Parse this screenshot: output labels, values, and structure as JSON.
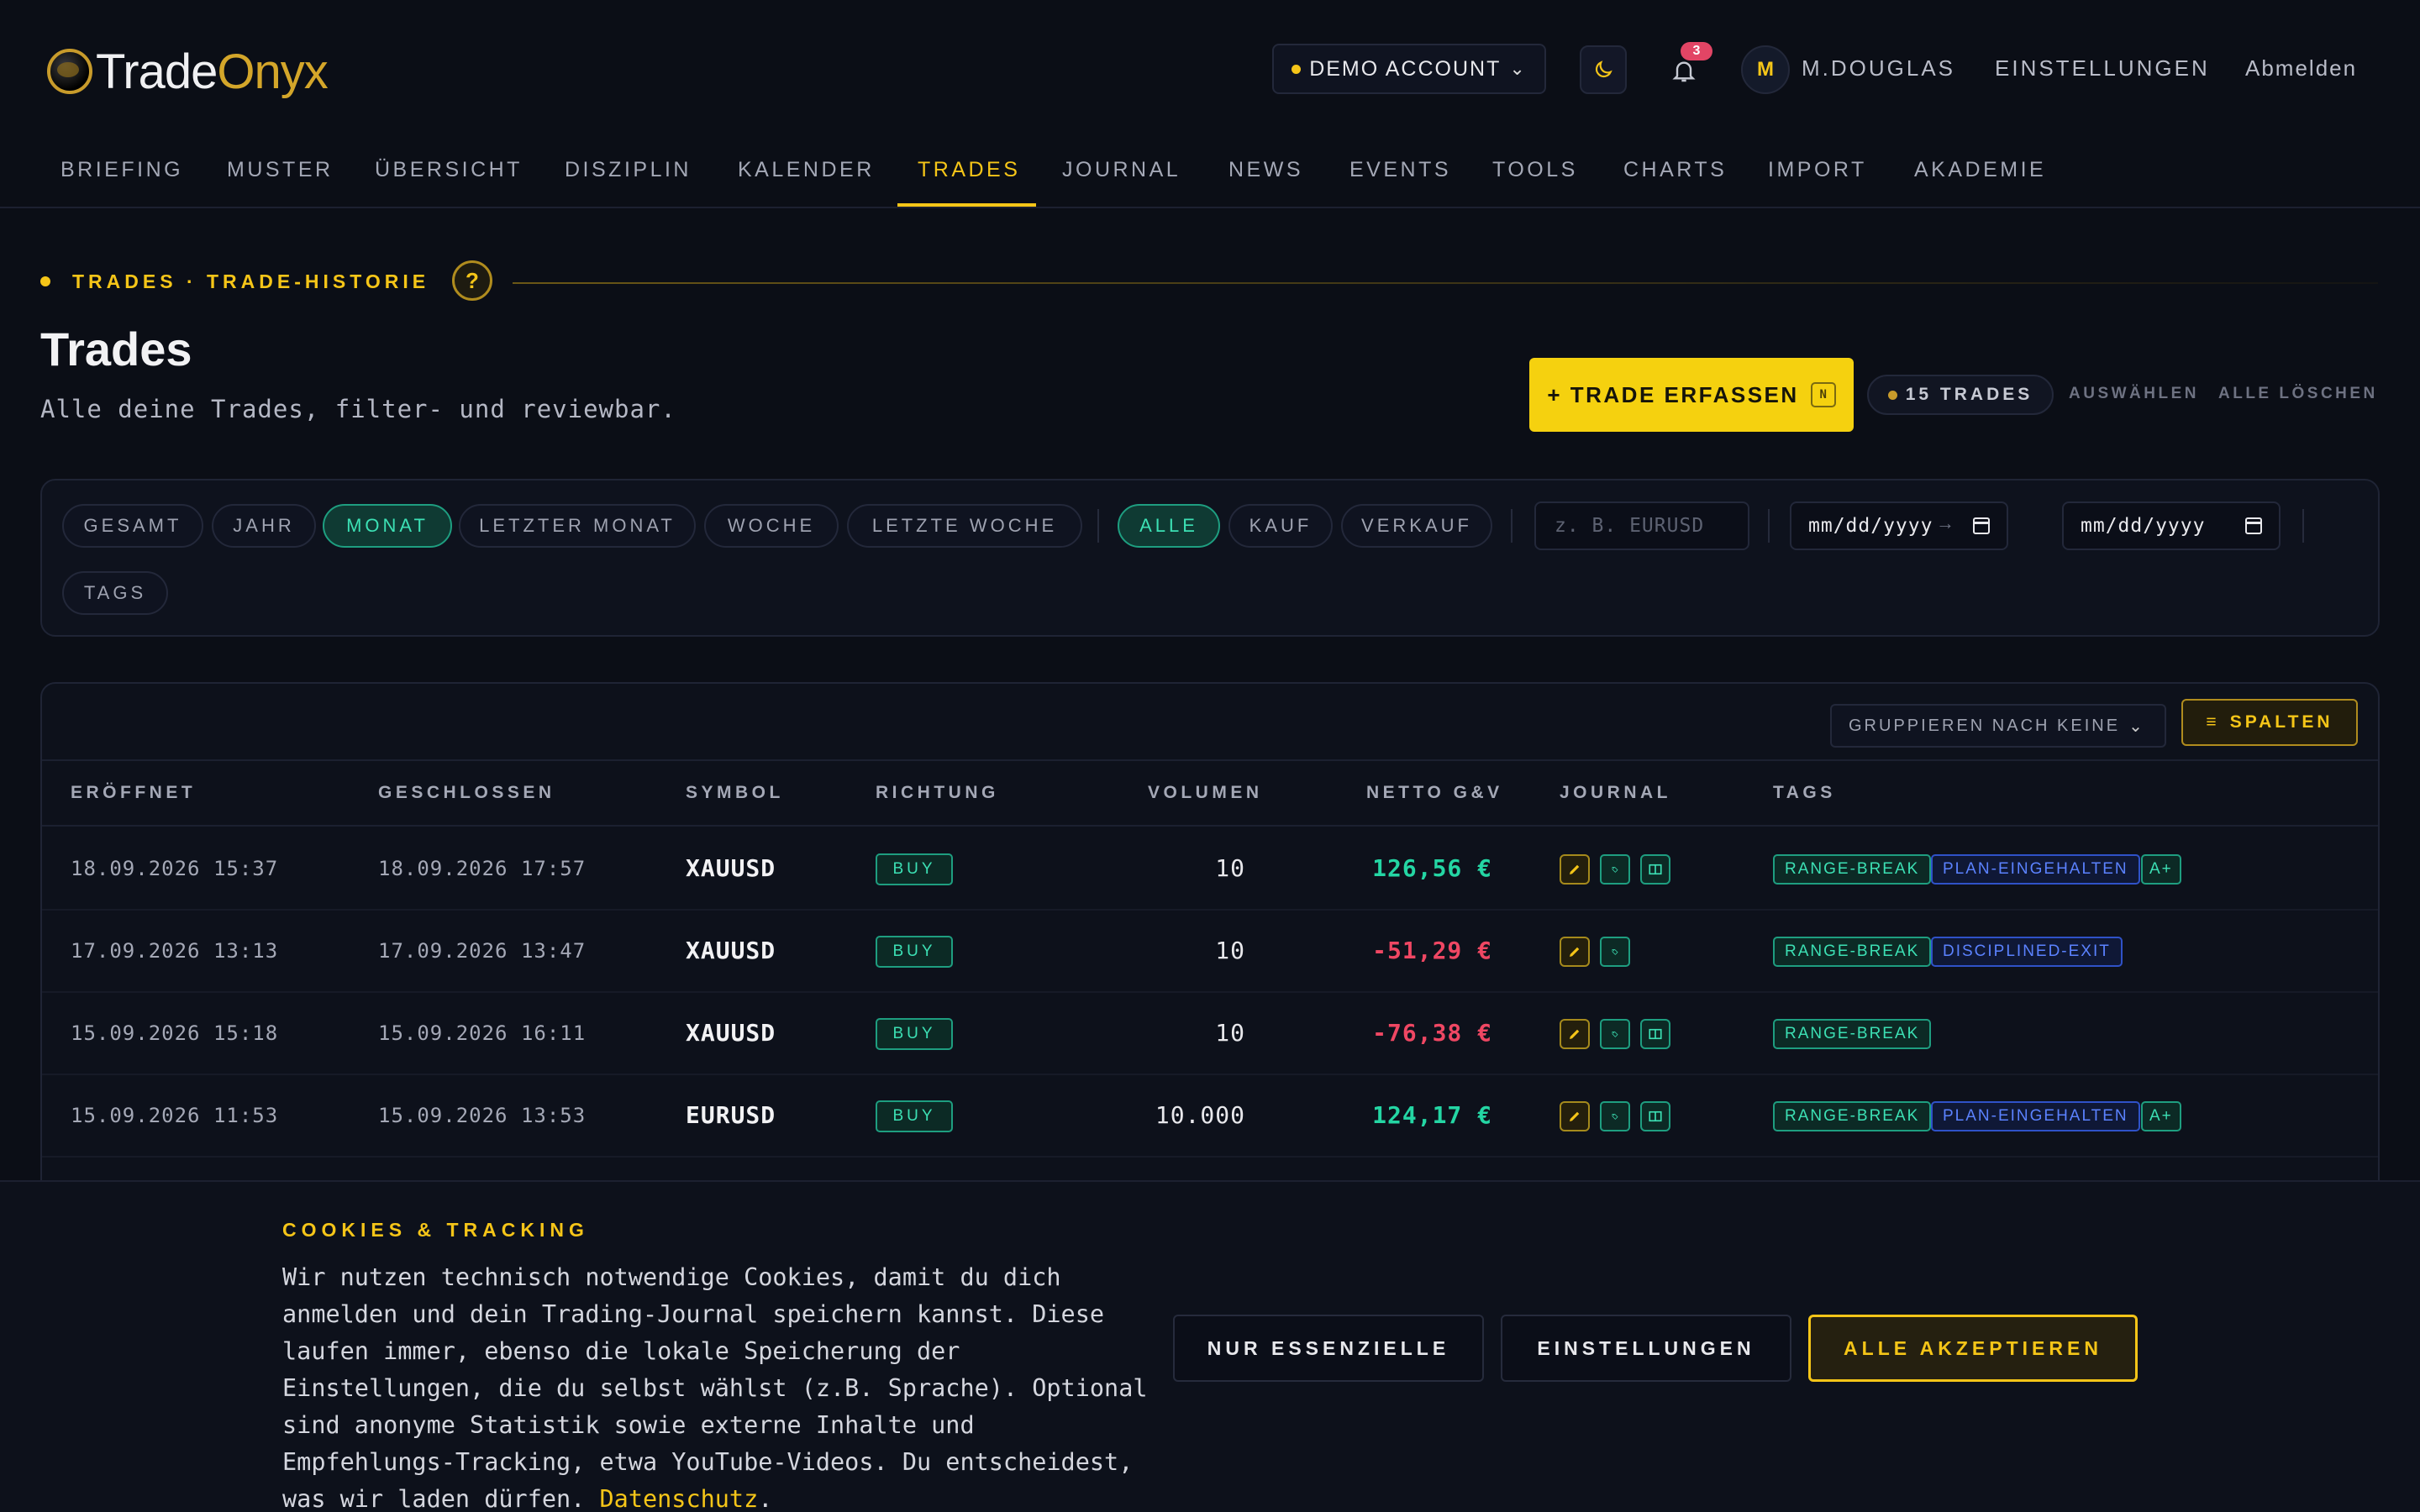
{
  "header": {
    "logo_prefix": "Trade",
    "logo_accent": "Onyx",
    "account": "DEMO ACCOUNT",
    "notification_count": "3",
    "avatar_initial": "M",
    "username": "M.DOUGLAS",
    "settings": "EINSTELLUNGEN",
    "logout": "Abmelden"
  },
  "nav": {
    "items": [
      "BRIEFING",
      "MUSTER",
      "ÜBERSICHT",
      "DISZIPLIN",
      "KALENDER",
      "TRADES",
      "JOURNAL",
      "NEWS",
      "EVENTS",
      "TOOLS",
      "CHARTS",
      "IMPORT",
      "AKADEMIE"
    ],
    "active": "TRADES"
  },
  "page": {
    "breadcrumb": "TRADES · TRADE-HISTORIE",
    "help": "?",
    "title": "Trades",
    "subtitle": "Alle deine Trades, filter- und reviewbar.",
    "add_button": "+ TRADE ERFASSEN",
    "add_shortcut": "N",
    "trade_count": "15 TRADES",
    "select": "AUSWÄHLEN",
    "delete_all": "ALLE LÖSCHEN"
  },
  "filters": {
    "periods": [
      "GESAMT",
      "JAHR",
      "MONAT",
      "LETZTER MONAT",
      "WOCHE",
      "LETZTE WOCHE"
    ],
    "active_period": "MONAT",
    "directions": [
      "ALLE",
      "KAUF",
      "VERKAUF"
    ],
    "active_direction": "ALLE",
    "symbol_placeholder": "z. B. EURUSD",
    "date_from": "mm/dd/yyyy",
    "date_to": "mm/dd/yyyy",
    "range_arrow": "→",
    "tags": "TAGS"
  },
  "table": {
    "group_by": "GRUPPIEREN NACH KEINE",
    "columns_button": "SPALTEN",
    "headers": [
      "ERÖFFNET",
      "GESCHLOSSEN",
      "SYMBOL",
      "RICHTUNG",
      "VOLUMEN",
      "NETTO G&V",
      "JOURNAL",
      "TAGS"
    ],
    "rows": [
      {
        "opened": "18.09.2026 15:37",
        "closed": "18.09.2026 17:57",
        "symbol": "XAUUSD",
        "direction": "BUY",
        "volume": "10",
        "pnl": "126,56 €",
        "pnl_sign": "positive",
        "journal_icons": [
          "pencil-icon",
          "tag-icon",
          "book-icon"
        ],
        "tags": [
          {
            "label": "RANGE-BREAK",
            "color": "#3ce0b4"
          },
          {
            "label": "PLAN-EINGEHALTEN",
            "color": "#5b82ff"
          },
          {
            "label": "A+",
            "color": "#3ce0b4"
          }
        ]
      },
      {
        "opened": "17.09.2026 13:13",
        "closed": "17.09.2026 13:47",
        "symbol": "XAUUSD",
        "direction": "BUY",
        "volume": "10",
        "pnl": "-51,29 €",
        "pnl_sign": "negative",
        "journal_icons": [
          "pencil-icon",
          "tag-icon"
        ],
        "tags": [
          {
            "label": "RANGE-BREAK",
            "color": "#3ce0b4"
          },
          {
            "label": "DISCIPLINED-EXIT",
            "color": "#5b82ff"
          }
        ]
      },
      {
        "opened": "15.09.2026 15:18",
        "closed": "15.09.2026 16:11",
        "symbol": "XAUUSD",
        "direction": "BUY",
        "volume": "10",
        "pnl": "-76,38 €",
        "pnl_sign": "negative",
        "journal_icons": [
          "pencil-icon",
          "tag-icon",
          "book-icon"
        ],
        "tags": [
          {
            "label": "RANGE-BREAK",
            "color": "#3ce0b4"
          }
        ]
      },
      {
        "opened": "15.09.2026 11:53",
        "closed": "15.09.2026 13:53",
        "symbol": "EURUSD",
        "direction": "BUY",
        "volume": "10.000",
        "pnl": "124,17 €",
        "pnl_sign": "positive",
        "journal_icons": [
          "pencil-icon",
          "tag-icon",
          "book-icon"
        ],
        "tags": [
          {
            "label": "RANGE-BREAK",
            "color": "#3ce0b4"
          },
          {
            "label": "PLAN-EINGEHALTEN",
            "color": "#5b82ff"
          },
          {
            "label": "A+",
            "color": "#3ce0b4"
          }
        ]
      }
    ]
  },
  "cookie": {
    "title": "COOKIES & TRACKING",
    "text": "Wir nutzen technisch notwendige Cookies, damit du dich anmelden und dein Trading-Journal speichern kannst. Diese laufen immer, ebenso die lokale Speicherung der Einstellungen, die du selbst wählst (z.B. Sprache). Optional sind anonyme Statistik sowie externe Inhalte und Empfehlungs-Tracking, etwa YouTube-Videos. Du entscheidest, was wir laden dürfen.",
    "privacy_link": "Datenschutz",
    "period": ".",
    "essential_only": "NUR ESSENZIELLE",
    "settings": "EINSTELLUNGEN",
    "accept_all": "ALLE AKZEPTIEREN"
  },
  "colors": {
    "accent": "#f5c518",
    "positive": "#24d6a4",
    "negative": "#ef4763",
    "tag_blue": "#5b82ff",
    "background": "#0b0e16"
  }
}
